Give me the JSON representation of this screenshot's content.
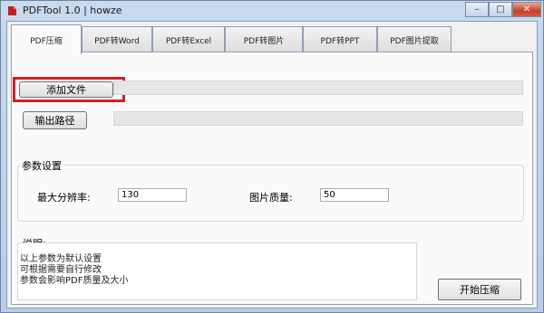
{
  "window": {
    "title": "PDFTool 1.0  |  howze",
    "minimize_glyph": "–",
    "maximize_glyph": "□",
    "close_glyph": "✕"
  },
  "tabs": [
    {
      "label": "PDF压缩",
      "active": true
    },
    {
      "label": "PDF转Word",
      "active": false
    },
    {
      "label": "PDF转Excel",
      "active": false
    },
    {
      "label": "PDF转图片",
      "active": false
    },
    {
      "label": "PDF转PPT",
      "active": false
    },
    {
      "label": "PDF图片提取",
      "active": false
    }
  ],
  "compress": {
    "add_file_label": "添加文件",
    "add_file_path": "",
    "output_path_label": "输出路径",
    "output_path": "",
    "params": {
      "title": "参数设置",
      "max_resolution_label": "最大分辨率:",
      "max_resolution_value": "130",
      "image_quality_label": "图片质量:",
      "image_quality_value": "50"
    },
    "notes": {
      "title": "说明:",
      "lines": [
        "以上参数为默认设置",
        "可根据需要自行修改",
        "参数会影响PDF质量及大小"
      ]
    },
    "start_label": "开始压缩"
  },
  "colors": {
    "highlight": "#d81e1e",
    "close_button": "#c6402a"
  },
  "icons": {
    "app": "pdf-app-icon"
  }
}
